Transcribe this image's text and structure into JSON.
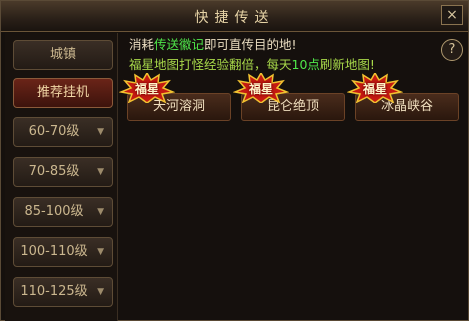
{
  "window": {
    "title": "快捷传送",
    "close_icon": "×"
  },
  "sidebar": {
    "items": [
      {
        "label": "城镇",
        "active": false
      },
      {
        "label": "推荐挂机",
        "active": true
      }
    ],
    "dropdowns": [
      {
        "label": "60-70级"
      },
      {
        "label": "70-85级"
      },
      {
        "label": "85-100级"
      },
      {
        "label": "100-110级"
      },
      {
        "label": "110-125级"
      }
    ],
    "dropdown_arrow": "▼"
  },
  "info": {
    "line1_a": "消耗",
    "line1_b": "传送徽记",
    "line1_c": "即可直传目的地!",
    "line2_a": "福星地图打怪经验翻倍，每天",
    "line2_b": "10点",
    "line2_c": "刷新地图!"
  },
  "help": {
    "label": "?"
  },
  "maps": [
    {
      "name": "天河溶洞",
      "badge": "福星"
    },
    {
      "name": "昆仑绝顶",
      "badge": "福星"
    },
    {
      "name": "冰晶峡谷",
      "badge": "福星"
    }
  ],
  "colors": {
    "accent_green": "#4fe84a",
    "text_yellow_green": "#a8d94a",
    "badge_red": "#c41a12",
    "badge_gold": "#f2c230"
  }
}
